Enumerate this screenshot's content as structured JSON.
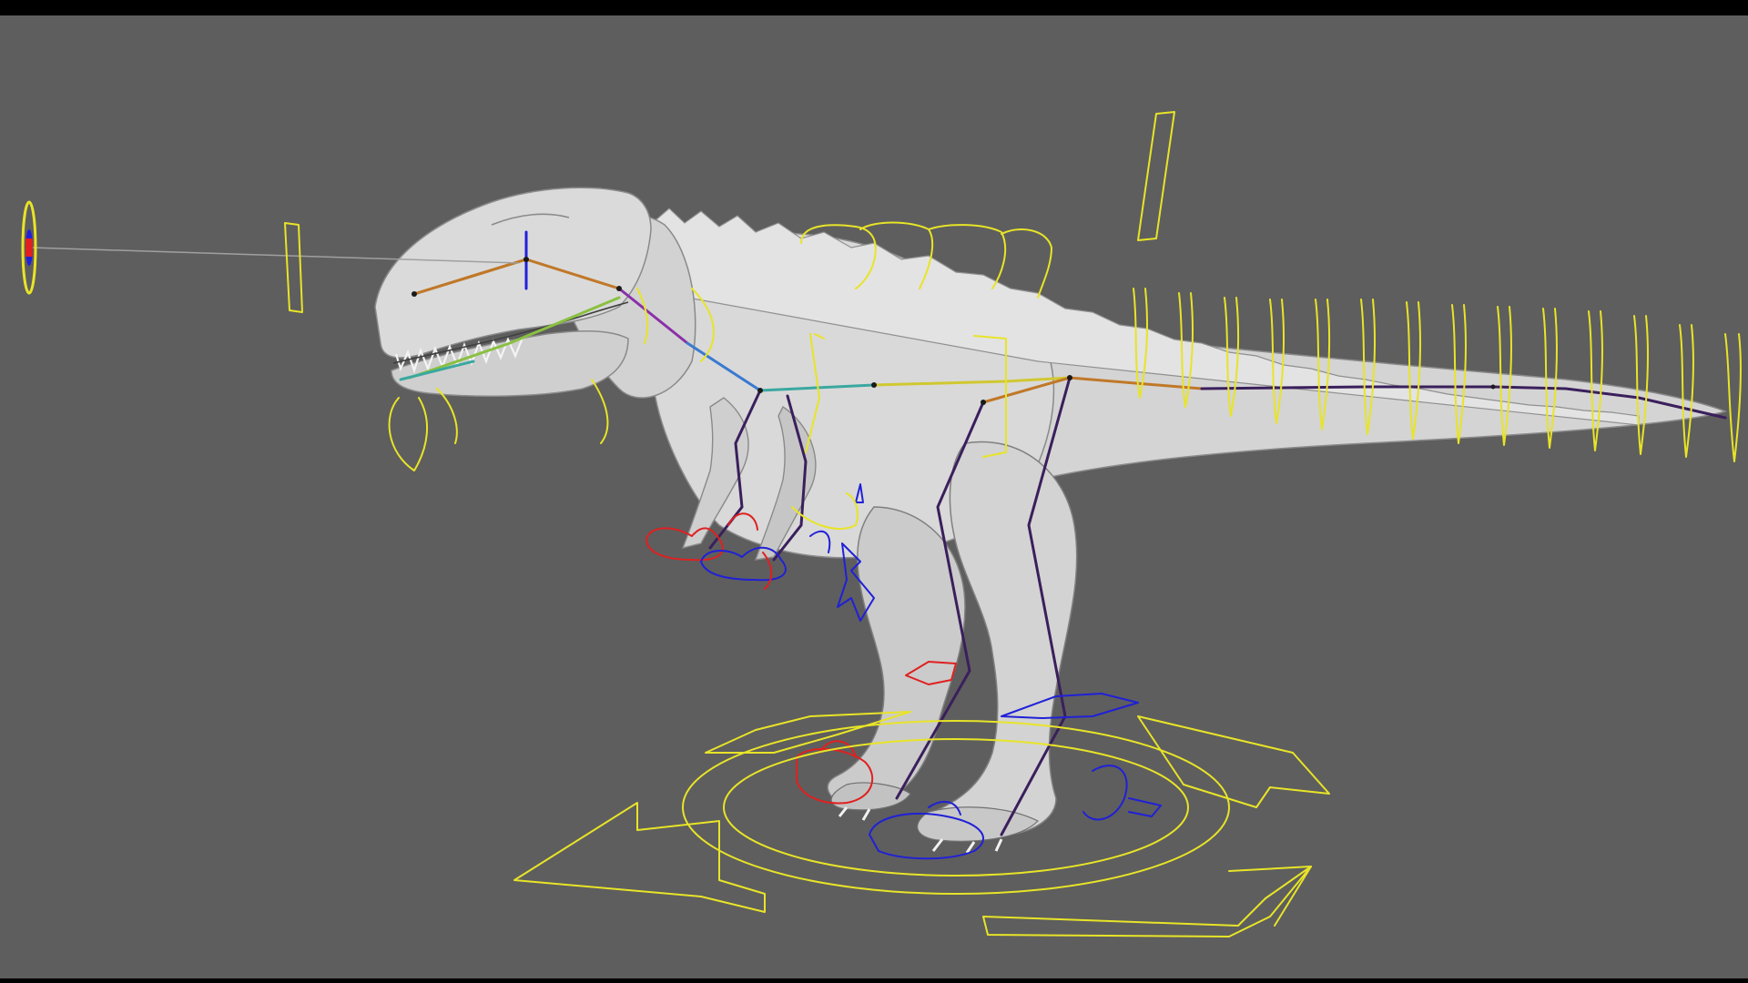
{
  "viewport": {
    "background": "#5e5e5e",
    "frame": "#000000"
  },
  "colors": {
    "control_main": "#e8e428",
    "control_left": "#e02020",
    "control_right": "#2020d8",
    "mesh_fill": "#d8d8d8",
    "mesh_shade": "#a8a8a8",
    "mesh_dark": "#7a7a7a",
    "bone_spine": "#3a1f5c",
    "bone_orange": "#c07828",
    "bone_teal": "#3aa8a0",
    "bone_purple": "#8a30a8"
  },
  "icons": {
    "camera_target": "camera-target-icon",
    "world_mover": "world-move-arrows-icon"
  }
}
